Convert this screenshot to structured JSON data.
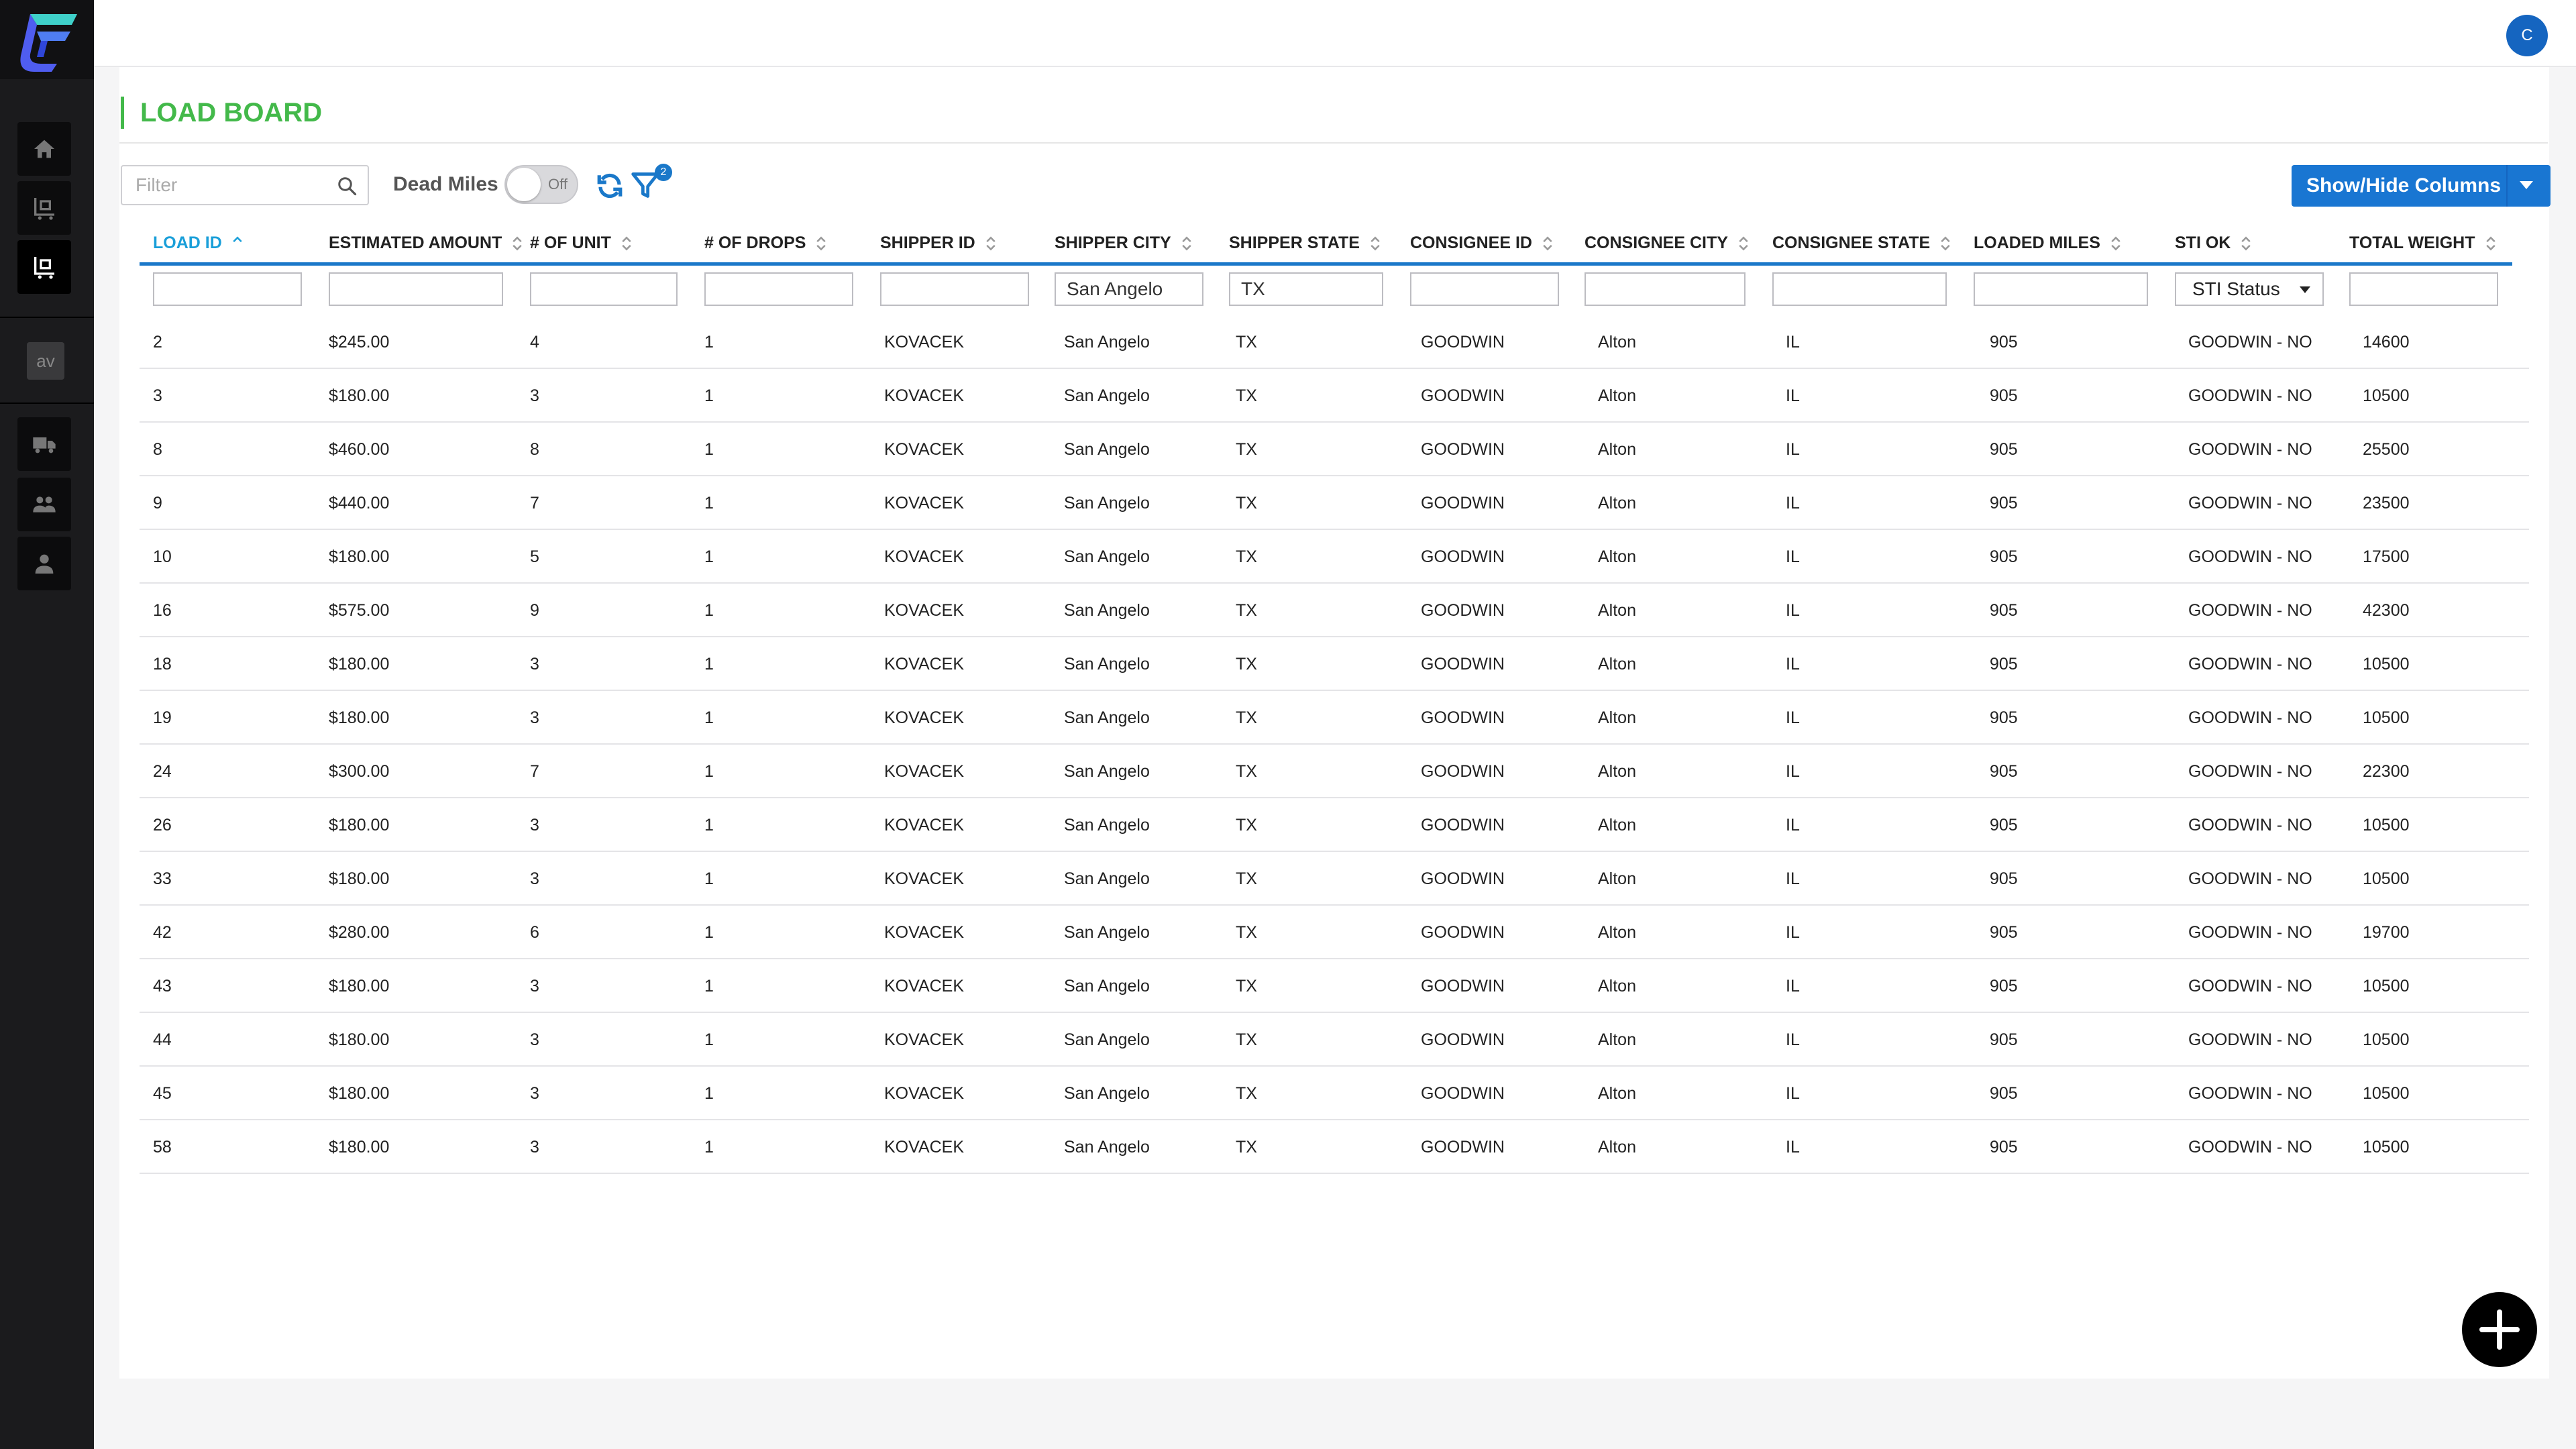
{
  "sidebar": {
    "logo_icon": "app-logo-icon",
    "items": [
      {
        "name": "home",
        "icon": "home-icon"
      },
      {
        "name": "loads",
        "icon": "load-board-icon"
      },
      {
        "name": "load-board",
        "icon": "load-board-icon"
      },
      {
        "name": "avatar",
        "label": "av"
      },
      {
        "name": "trucks",
        "icon": "truck-icon"
      },
      {
        "name": "users",
        "icon": "users-icon"
      },
      {
        "name": "profile",
        "icon": "user-icon"
      }
    ]
  },
  "header": {
    "user_initial": "C"
  },
  "page": {
    "title": "LOAD BOARD"
  },
  "toolbar": {
    "filter_placeholder": "Filter",
    "dead_miles_label": "Dead Miles",
    "toggle_state": "Off",
    "filter_count": "2",
    "show_hide_label": "Show/Hide Columns"
  },
  "table": {
    "columns": [
      {
        "key": "load_id",
        "label": "LOAD ID",
        "sorted": "asc"
      },
      {
        "key": "estimated_amount",
        "label": "ESTIMATED AMOUNT"
      },
      {
        "key": "units",
        "label": "# OF UNIT"
      },
      {
        "key": "drops",
        "label": "# OF DROPS"
      },
      {
        "key": "shipper_id",
        "label": "SHIPPER ID"
      },
      {
        "key": "shipper_city",
        "label": "SHIPPER CITY"
      },
      {
        "key": "shipper_state",
        "label": "SHIPPER STATE"
      },
      {
        "key": "consignee_id",
        "label": "CONSIGNEE ID"
      },
      {
        "key": "consignee_city",
        "label": "CONSIGNEE CITY"
      },
      {
        "key": "consignee_state",
        "label": "CONSIGNEE STATE"
      },
      {
        "key": "loaded_miles",
        "label": "LOADED MILES"
      },
      {
        "key": "sti_ok",
        "label": "STI OK"
      },
      {
        "key": "total_weight",
        "label": "TOTAL WEIGHT"
      }
    ],
    "filters": {
      "shipper_city": "San Angelo",
      "shipper_state": "TX",
      "sti_status": "STI Status"
    },
    "rows": [
      [
        "2",
        "$245.00",
        "4",
        "1",
        "KOVACEK",
        "San Angelo",
        "TX",
        "GOODWIN",
        "Alton",
        "IL",
        "905",
        "GOODWIN - NO",
        "14600"
      ],
      [
        "3",
        "$180.00",
        "3",
        "1",
        "KOVACEK",
        "San Angelo",
        "TX",
        "GOODWIN",
        "Alton",
        "IL",
        "905",
        "GOODWIN - NO",
        "10500"
      ],
      [
        "8",
        "$460.00",
        "8",
        "1",
        "KOVACEK",
        "San Angelo",
        "TX",
        "GOODWIN",
        "Alton",
        "IL",
        "905",
        "GOODWIN - NO",
        "25500"
      ],
      [
        "9",
        "$440.00",
        "7",
        "1",
        "KOVACEK",
        "San Angelo",
        "TX",
        "GOODWIN",
        "Alton",
        "IL",
        "905",
        "GOODWIN - NO",
        "23500"
      ],
      [
        "10",
        "$180.00",
        "5",
        "1",
        "KOVACEK",
        "San Angelo",
        "TX",
        "GOODWIN",
        "Alton",
        "IL",
        "905",
        "GOODWIN - NO",
        "17500"
      ],
      [
        "16",
        "$575.00",
        "9",
        "1",
        "KOVACEK",
        "San Angelo",
        "TX",
        "GOODWIN",
        "Alton",
        "IL",
        "905",
        "GOODWIN - NO",
        "42300"
      ],
      [
        "18",
        "$180.00",
        "3",
        "1",
        "KOVACEK",
        "San Angelo",
        "TX",
        "GOODWIN",
        "Alton",
        "IL",
        "905",
        "GOODWIN - NO",
        "10500"
      ],
      [
        "19",
        "$180.00",
        "3",
        "1",
        "KOVACEK",
        "San Angelo",
        "TX",
        "GOODWIN",
        "Alton",
        "IL",
        "905",
        "GOODWIN - NO",
        "10500"
      ],
      [
        "24",
        "$300.00",
        "7",
        "1",
        "KOVACEK",
        "San Angelo",
        "TX",
        "GOODWIN",
        "Alton",
        "IL",
        "905",
        "GOODWIN - NO",
        "22300"
      ],
      [
        "26",
        "$180.00",
        "3",
        "1",
        "KOVACEK",
        "San Angelo",
        "TX",
        "GOODWIN",
        "Alton",
        "IL",
        "905",
        "GOODWIN - NO",
        "10500"
      ],
      [
        "33",
        "$180.00",
        "3",
        "1",
        "KOVACEK",
        "San Angelo",
        "TX",
        "GOODWIN",
        "Alton",
        "IL",
        "905",
        "GOODWIN - NO",
        "10500"
      ],
      [
        "42",
        "$280.00",
        "6",
        "1",
        "KOVACEK",
        "San Angelo",
        "TX",
        "GOODWIN",
        "Alton",
        "IL",
        "905",
        "GOODWIN - NO",
        "19700"
      ],
      [
        "43",
        "$180.00",
        "3",
        "1",
        "KOVACEK",
        "San Angelo",
        "TX",
        "GOODWIN",
        "Alton",
        "IL",
        "905",
        "GOODWIN - NO",
        "10500"
      ],
      [
        "44",
        "$180.00",
        "3",
        "1",
        "KOVACEK",
        "San Angelo",
        "TX",
        "GOODWIN",
        "Alton",
        "IL",
        "905",
        "GOODWIN - NO",
        "10500"
      ],
      [
        "45",
        "$180.00",
        "3",
        "1",
        "KOVACEK",
        "San Angelo",
        "TX",
        "GOODWIN",
        "Alton",
        "IL",
        "905",
        "GOODWIN - NO",
        "10500"
      ],
      [
        "58",
        "$180.00",
        "3",
        "1",
        "KOVACEK",
        "San Angelo",
        "TX",
        "GOODWIN",
        "Alton",
        "IL",
        "905",
        "GOODWIN - NO",
        "10500"
      ]
    ]
  },
  "colors": {
    "accent": "#1a78c9",
    "title_green": "#43b94a",
    "button_blue": "#1976d2"
  }
}
